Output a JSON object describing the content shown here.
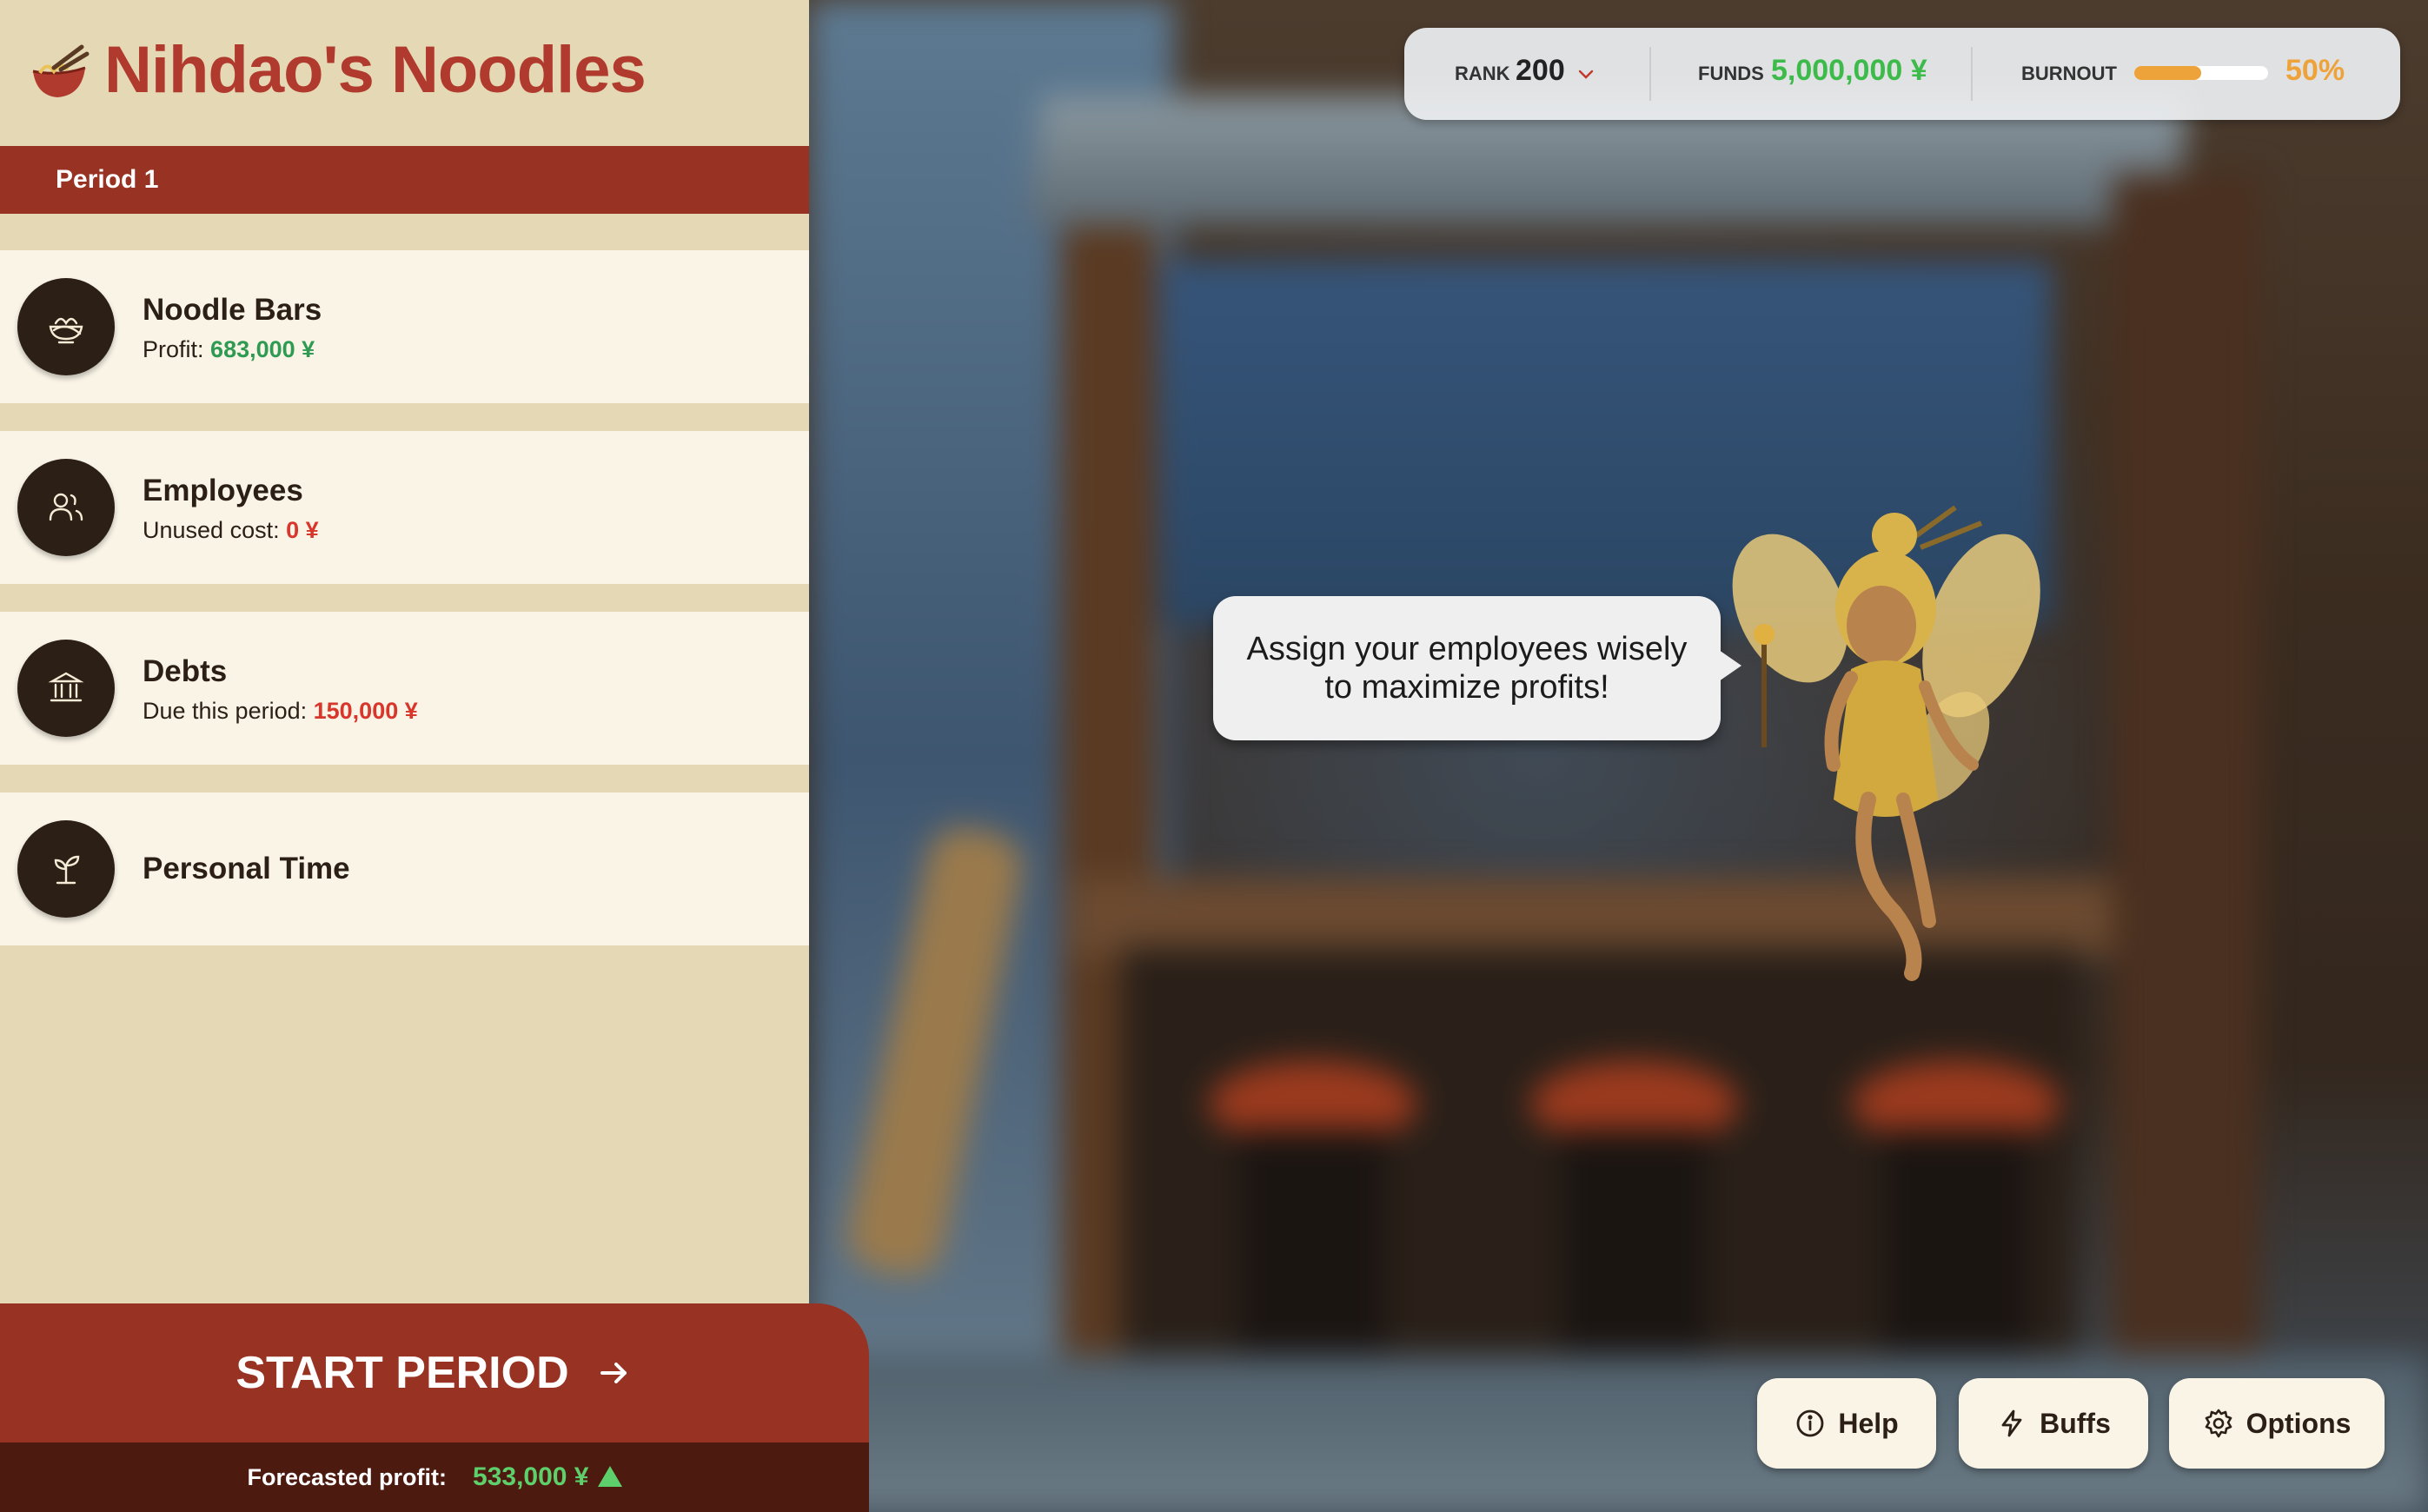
{
  "app": {
    "title": "Nihdao's Noodles"
  },
  "period": {
    "label": "Period 1"
  },
  "cards": [
    {
      "name": "Noodle Bars",
      "sub_label": "Profit:",
      "sub_value": "683,000 ¥",
      "icon": "noodle-bowl-icon"
    },
    {
      "name": "Employees",
      "sub_label": "Unused cost:",
      "sub_value": "0 ¥",
      "icon": "people-icon"
    },
    {
      "name": "Debts",
      "sub_label": "Due this period:",
      "sub_value": "150,000 ¥",
      "icon": "bank-icon"
    },
    {
      "name": "Personal Time",
      "icon": "sprout-icon"
    }
  ],
  "start": {
    "label": "START PERIOD",
    "forecast_label": "Forecasted profit:",
    "forecast_value": "533,000 ¥"
  },
  "stats": {
    "rank_label": "RANK",
    "rank_value": "200",
    "funds_label": "FUNDS",
    "funds_value": "5,000,000 ¥",
    "burnout_label": "BURNOUT",
    "burnout_value": "50%",
    "burnout_fraction": 0.5
  },
  "fairy": {
    "speech": "Assign your employees wisely to maximize profits!"
  },
  "buttons": {
    "help": "Help",
    "buffs": "Buffs",
    "options": "Options"
  },
  "colors": {
    "accent_red": "#983222",
    "title_red": "#b03a2e",
    "profit_green": "#2f9a52",
    "cost_red": "#d8352b",
    "funds_green": "#3dbb4a",
    "burnout_orange": "#eea23a"
  }
}
